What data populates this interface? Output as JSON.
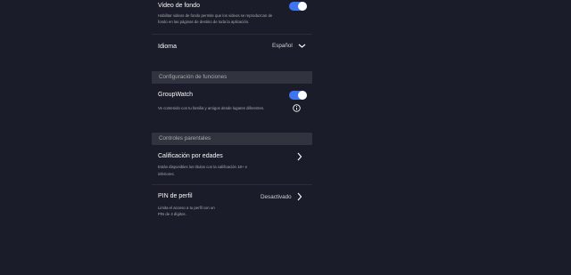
{
  "settings": {
    "video_fondo": {
      "label": "Video de fondo",
      "description_line1": "Habilitar videos de fondo permite que los videos se reproduzcan de",
      "description_line2": "fondo en las páginas de destino de toda la aplicación.",
      "enabled": true
    },
    "idioma": {
      "label": "Idioma",
      "value": "Español"
    },
    "features_section": {
      "header": "Configuración de funciones",
      "groupwatch": {
        "label": "GroupWatch",
        "description": "Ve contenido con tu familia y amigos desde lugares diferentes.",
        "enabled": true
      }
    },
    "parental_section": {
      "header": "Controles parentales",
      "rating": {
        "label": "Calificación por edades",
        "description_line1": "Están disponibles los títulos con la calificación 18+ e",
        "description_line2": "inferiores."
      },
      "pin": {
        "label": "PIN de perfil",
        "value": "Desactivado",
        "description_line1": "Limita el acceso a tu perfil con un",
        "description_line2": "PIN de 4 dígitos."
      }
    }
  },
  "colors": {
    "background": "#1a1d29",
    "section_header_bg": "#31343e",
    "toggle_on": "#3f74f0",
    "text_primary": "#f9f9f9",
    "text_secondary": "#a8a9ad"
  },
  "icons": {
    "dropdown": "chevron-down-icon",
    "forward": "chevron-right-icon",
    "info": "info-icon"
  }
}
